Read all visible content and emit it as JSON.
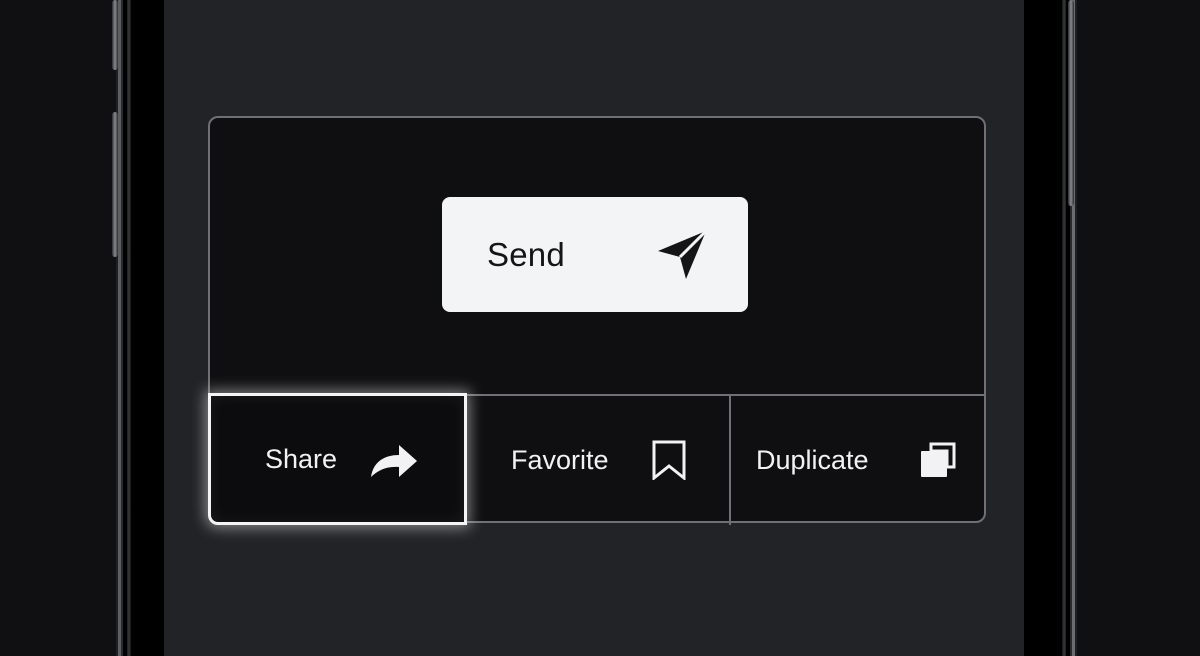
{
  "primary_action": {
    "label": "Send",
    "icon": "paper-plane-icon"
  },
  "actions": [
    {
      "label": "Share",
      "icon": "share-arrow-icon",
      "focused": true
    },
    {
      "label": "Favorite",
      "icon": "bookmark-icon",
      "focused": false
    },
    {
      "label": "Duplicate",
      "icon": "copy-icon",
      "focused": false
    }
  ],
  "colors": {
    "screen_background": "#222326",
    "card_background": "#0f0f11",
    "card_border": "#6f7074",
    "button_background": "#f3f4f6",
    "button_text": "#151518",
    "action_text": "#f2f2f4",
    "focus_ring": "#f4f4f6"
  }
}
